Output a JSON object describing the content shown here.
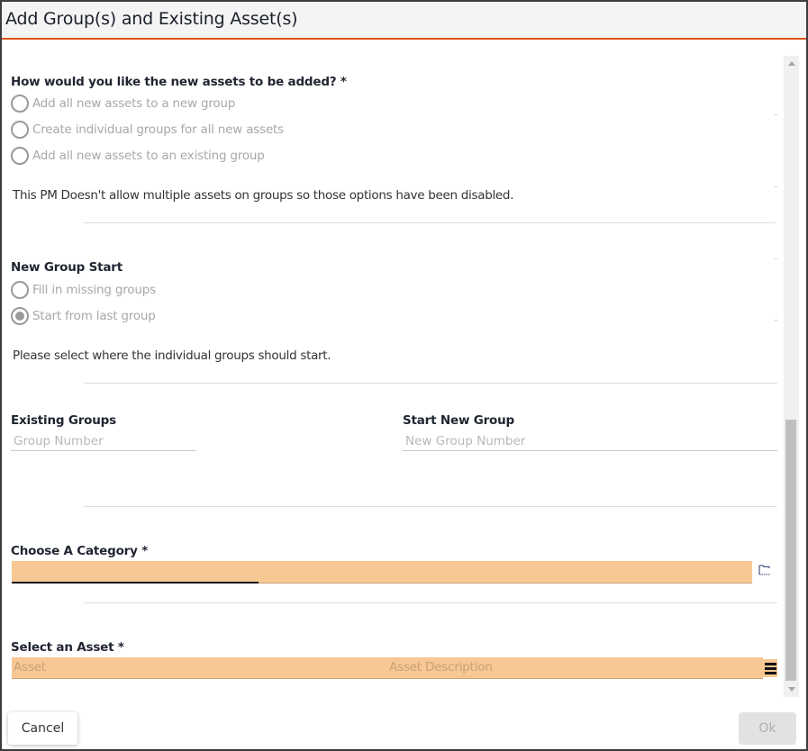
{
  "dialog": {
    "title": "Add Group(s) and Existing Asset(s)"
  },
  "add_mode": {
    "question": "How would you like the new assets to be added? *",
    "options": [
      {
        "label": "Add all new assets to a new group",
        "selected": false,
        "disabled": true
      },
      {
        "label": "Create individual groups for all new assets",
        "selected": false,
        "disabled": true
      },
      {
        "label": "Add all new assets to an existing group",
        "selected": false,
        "disabled": true
      }
    ],
    "note": "This PM Doesn't allow multiple assets on groups so those options have been disabled."
  },
  "group_start": {
    "heading": "New Group Start",
    "options": [
      {
        "label": "Fill in missing groups",
        "selected": false,
        "disabled": true
      },
      {
        "label": "Start from last group",
        "selected": true,
        "disabled": true
      }
    ],
    "note": "Please select where the individual groups should start."
  },
  "existing_groups": {
    "label": "Existing Groups",
    "placeholder": "Group Number",
    "value": ""
  },
  "start_new_group": {
    "label": "Start New Group",
    "placeholder": "New Group Number",
    "value": ""
  },
  "category": {
    "label": "Choose A Category *",
    "value": "",
    "browse_icon": "folder-browse-icon"
  },
  "asset": {
    "label": "Select an Asset *",
    "asset_placeholder": "Asset",
    "description_placeholder": "Asset Description",
    "menu_icon": "hamburger-menu-icon"
  },
  "footer": {
    "cancel_label": "Cancel",
    "ok_label": "Ok"
  },
  "colors": {
    "accent": "#e0501a",
    "required_field_bg": "#f7c893",
    "disabled_text": "#a8a8a8"
  }
}
